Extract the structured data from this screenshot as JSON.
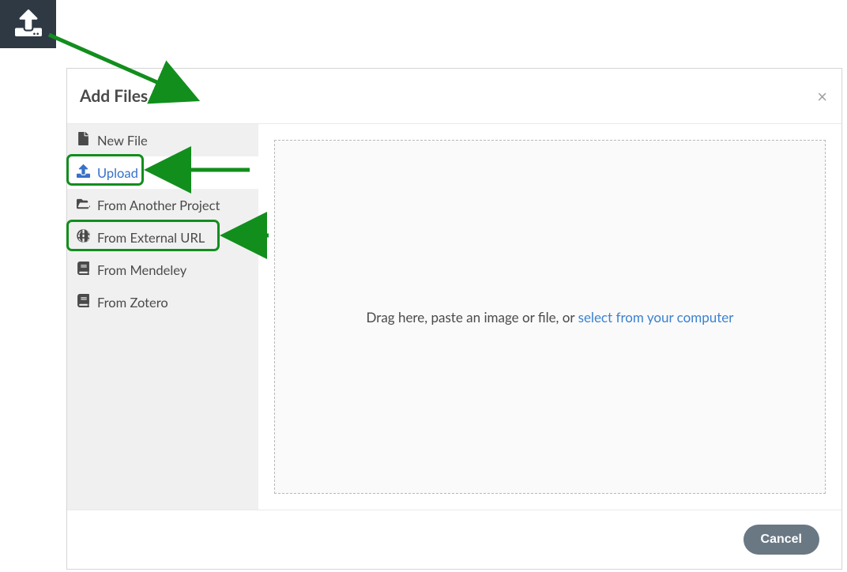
{
  "modal": {
    "title": "Add Files",
    "close_glyph": "×"
  },
  "sidebar": {
    "items": [
      {
        "icon": "file-icon",
        "label": "New File"
      },
      {
        "icon": "upload-icon",
        "label": "Upload"
      },
      {
        "icon": "folder-open-icon",
        "label": "From Another Project"
      },
      {
        "icon": "globe-icon",
        "label": "From External URL"
      },
      {
        "icon": "book-icon",
        "label": "From Mendeley"
      },
      {
        "icon": "book-icon",
        "label": "From Zotero"
      }
    ]
  },
  "dropzone": {
    "text_prefix": "Drag here, paste an image or file, or ",
    "link_text": "select from your computer"
  },
  "footer": {
    "cancel_label": "Cancel"
  }
}
